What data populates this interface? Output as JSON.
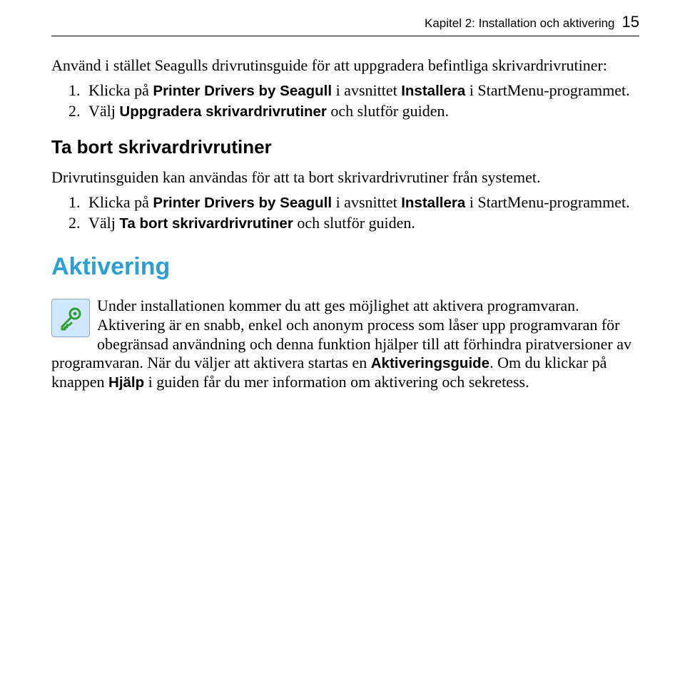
{
  "header": {
    "title": "Kapitel 2: Installation och aktivering",
    "page_number": "15"
  },
  "intro1": "Använd i stället Seagulls drivrutinsguide för att uppgradera befintliga skrivardrivrutiner:",
  "list1": {
    "item1_pre": "Klicka på ",
    "item1_bold": "Printer Drivers by Seagull",
    "item1_mid": " i avsnittet ",
    "item1_bold2": "Installera",
    "item1_post": " i StartMenu-programmet.",
    "item2_pre": "Välj ",
    "item2_bold": "Uppgradera skrivardrivrutiner",
    "item2_post": " och slutför guiden."
  },
  "section2_title": "Ta bort skrivardrivrutiner",
  "intro2": "Drivrutinsguiden kan användas för att ta bort skrivardrivrutiner från systemet.",
  "list2": {
    "item1_pre": "Klicka på ",
    "item1_bold": "Printer Drivers by Seagull",
    "item1_mid": " i avsnittet ",
    "item1_bold2": "Installera",
    "item1_post": " i StartMenu-programmet.",
    "item2_pre": "Välj ",
    "item2_bold": "Ta bort skrivardrivrutiner",
    "item2_post": " och slutför guiden."
  },
  "section3_title": "Aktivering",
  "note": {
    "p1": "Under installationen kommer du att ges möjlighet att aktivera programvaran. Aktivering är en snabb, enkel och anonym process som låser upp programvaran för obegränsad användning och denna funktion hjälper till att förhindra piratversioner av programvaran. När du väljer att aktivera startas en ",
    "p1_bold": "Aktiveringsguide",
    "p1_mid": ". Om du klickar på knappen ",
    "p1_bold2": "Hjälp",
    "p1_post": " i guiden får du mer information om aktivering och sekretess."
  }
}
